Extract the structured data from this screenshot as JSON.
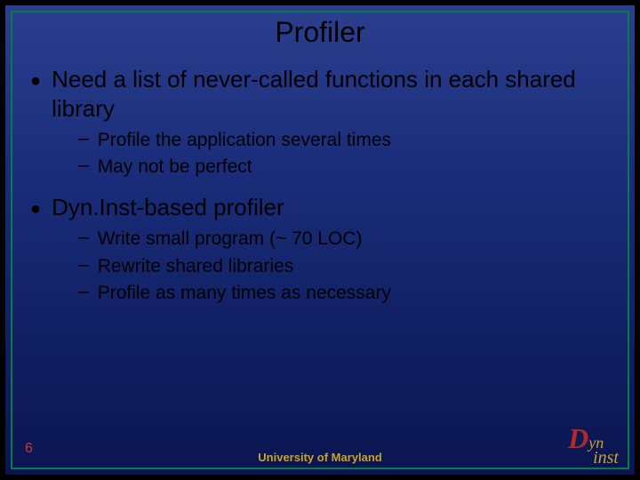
{
  "title": "Profiler",
  "bullets": [
    {
      "text": "Need a list of never-called functions in each shared library",
      "subs": [
        "Profile the application several times",
        "May not be perfect"
      ]
    },
    {
      "text": "Dyn.Inst-based profiler",
      "subs": [
        "Write small program (~ 70 LOC)",
        "Rewrite shared libraries",
        "Profile as many times as necessary"
      ]
    }
  ],
  "slide_number": "6",
  "footer": "University of Maryland",
  "logo": {
    "d": "D",
    "yn": "yn",
    "inst": "inst"
  }
}
